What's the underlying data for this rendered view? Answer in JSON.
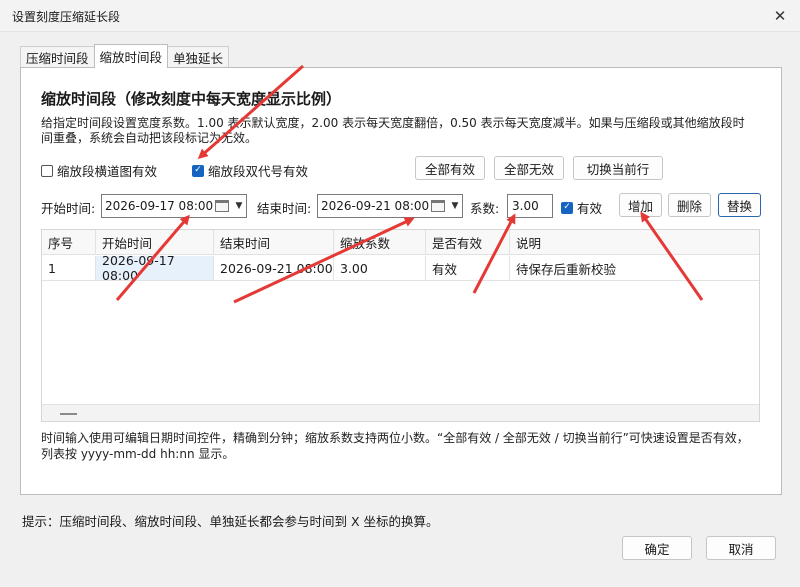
{
  "window": {
    "title": "设置刻度压缩延长段"
  },
  "tabs": [
    {
      "label": "压缩时间段",
      "active": false
    },
    {
      "label": "缩放时间段",
      "active": true
    },
    {
      "label": "单独延长",
      "active": false
    }
  ],
  "section": {
    "title": "缩放时间段（修改刻度中每天宽度显示比例）",
    "description": "给指定时间段设置宽度系数。1.00 表示默认宽度，2.00 表示每天宽度翻倍，0.50 表示每天宽度减半。如果与压缩段或其他缩放段时间重叠，系统会自动把该段标记为无效。"
  },
  "options": {
    "horizontal_chart": {
      "label": "缩放段横道图有效",
      "checked": false
    },
    "double_code": {
      "label": "缩放段双代号有效",
      "checked": true
    }
  },
  "bulk_buttons": {
    "all_valid": "全部有效",
    "all_invalid": "全部无效",
    "toggle_current": "切换当前行"
  },
  "editor": {
    "start_label": "开始时间:",
    "start_value": "2026-09-17 08:00",
    "end_label": "结束时间:",
    "end_value": "2026-09-21 08:00",
    "factor_label": "系数:",
    "factor_value": "3.00",
    "valid_label": "有效",
    "valid_checked": true,
    "add": "增加",
    "delete": "删除",
    "replace": "替换"
  },
  "table": {
    "columns": [
      "序号",
      "开始时间",
      "结束时间",
      "缩放系数",
      "是否有效",
      "说明"
    ],
    "rows": [
      [
        "1",
        "2026-09-17 08:00",
        "2026-09-21 08:00",
        "3.00",
        "有效",
        "待保存后重新校验"
      ]
    ]
  },
  "note": "时间输入使用可编辑日期时间控件，精确到分钟；缩放系数支持两位小数。“全部有效 / 全部无效 / 切换当前行”可快速设置是否有效，列表按 yyyy-mm-dd hh:nn 显示。",
  "hint": "提示：压缩时间段、缩放时间段、单独延长都会参与时间到 X 坐标的换算。",
  "footer": {
    "ok": "确定",
    "cancel": "取消"
  },
  "colors": {
    "accent": "#1565c0",
    "annotation": "#e53935"
  }
}
